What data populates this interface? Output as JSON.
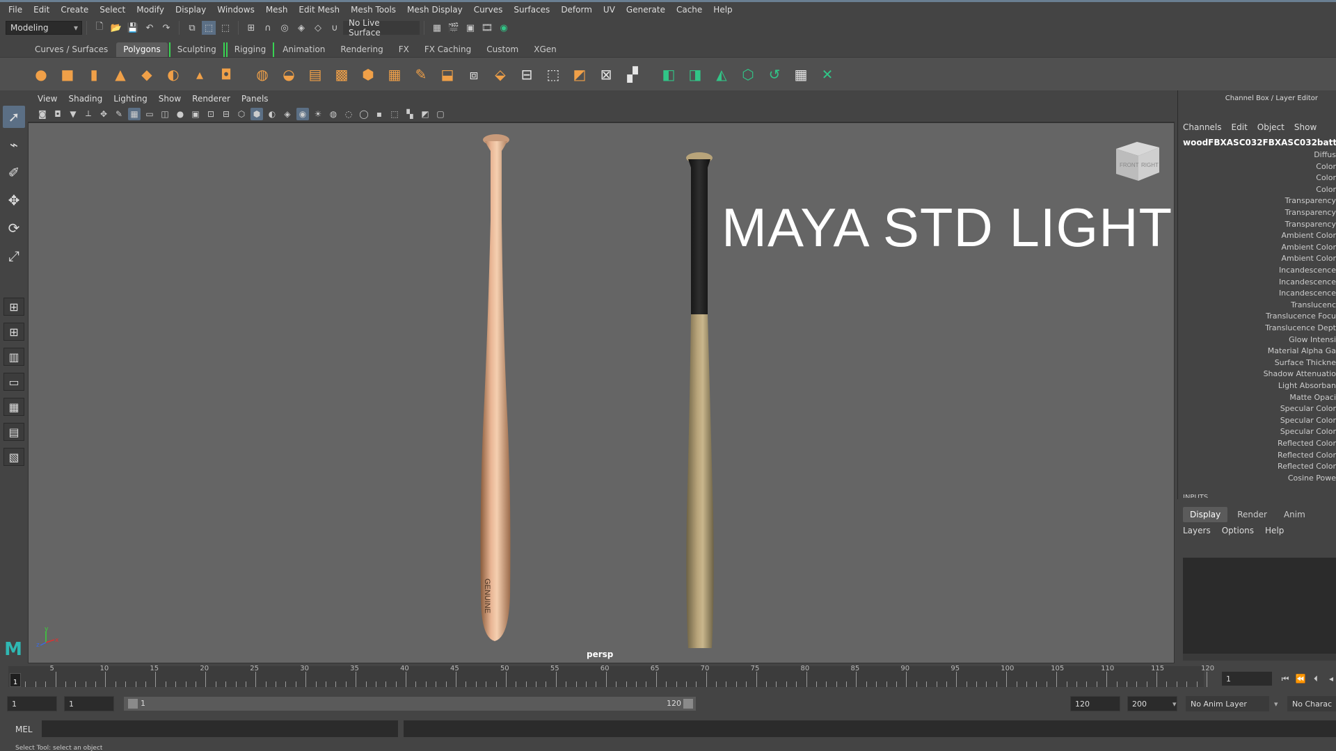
{
  "menubar": {
    "items": [
      "File",
      "Edit",
      "Create",
      "Select",
      "Modify",
      "Display",
      "Windows",
      "Mesh",
      "Edit Mesh",
      "Mesh Tools",
      "Mesh Display",
      "Curves",
      "Surfaces",
      "Deform",
      "UV",
      "Generate",
      "Cache",
      "Help"
    ]
  },
  "statusline": {
    "mode": "Modeling",
    "live_surface": "No Live Surface"
  },
  "shelf": {
    "tabs": [
      "Curves / Surfaces",
      "Polygons",
      "Sculpting",
      "Rigging",
      "Animation",
      "Rendering",
      "FX",
      "FX Caching",
      "Custom",
      "XGen"
    ],
    "active_tab": "Polygons"
  },
  "viewport": {
    "menu": [
      "View",
      "Shading",
      "Lighting",
      "Show",
      "Renderer",
      "Panels"
    ],
    "overlay_text": "MAYA STD LIGHT",
    "camera": "persp",
    "viewcube": {
      "front": "FRONT",
      "right": "RIGHT"
    },
    "bat_label": "GENUINE",
    "axis": {
      "x": "x",
      "y": "y",
      "z": "z"
    }
  },
  "channelbox": {
    "title": "Channel Box / Layer Editor",
    "menu": [
      "Channels",
      "Edit",
      "Object",
      "Show"
    ],
    "object_name": "woodFBXASC032FBXASC032batt",
    "attributes": [
      "Diffus",
      "Color",
      "Color",
      "Color",
      "Transparency",
      "Transparency",
      "Transparency",
      "Ambient Color",
      "Ambient Color",
      "Ambient Color",
      "Incandescence",
      "Incandescence",
      "Incandescence",
      "Translucenc",
      "Translucence Focu",
      "Translucence Dept",
      "Glow Intensi",
      "Material Alpha Ga",
      "Surface Thickne",
      "Shadow Attenuatio",
      "Light Absorban",
      "Matte Opaci",
      "Specular Color",
      "Specular Color",
      "Specular Color",
      "Reflected Color",
      "Reflected Color",
      "Reflected Color",
      "Cosine Powe"
    ],
    "inputs_label": "INPUTS"
  },
  "layer_editor": {
    "tabs": [
      "Display",
      "Render",
      "Anim"
    ],
    "active_tab": "Display",
    "menu": [
      "Layers",
      "Options",
      "Help"
    ]
  },
  "timeslider": {
    "labels": [
      "5",
      "10",
      "15",
      "20",
      "25",
      "30",
      "35",
      "40",
      "45",
      "50",
      "55",
      "60",
      "65",
      "70",
      "75",
      "80",
      "85",
      "90",
      "95",
      "100",
      "105",
      "110",
      "115",
      "120"
    ],
    "current_frame": "1",
    "frame_field": "1",
    "playback": [
      "⏮",
      "⏪",
      "⏴",
      "◂"
    ]
  },
  "rangeslider": {
    "start_field": "1",
    "playback_start": "1",
    "range_start": "1",
    "range_end": "120",
    "anim_end": "120",
    "max_end": "200",
    "anim_layer": "No Anim Layer",
    "character": "No Charac"
  },
  "cmdline": {
    "lang": "MEL",
    "help": "Select Tool: select an object"
  }
}
